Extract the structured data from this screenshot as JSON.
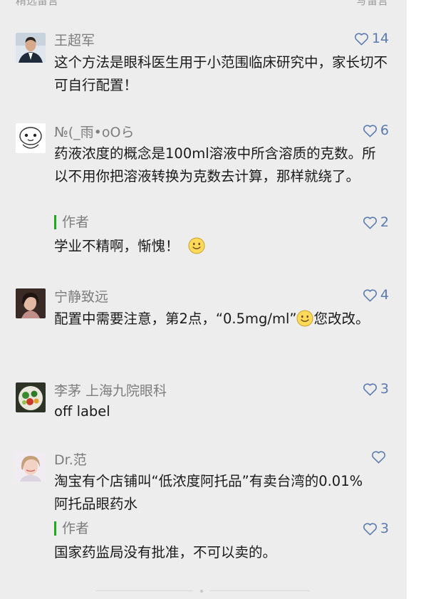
{
  "header_fragment": {
    "left": "精选留言",
    "right": "写留言"
  },
  "colors": {
    "like": "#5a7ab0",
    "author_bar": "#1aad19",
    "nickname": "#7d7d7d"
  },
  "comments": [
    {
      "nickname": "王超军",
      "likes": "14",
      "text": "这个方法是眼科医生用于小范围临床研究中，家长切不可自行配置！"
    },
    {
      "nickname": "№(_雨•oOら",
      "likes": "6",
      "text": "药液浓度的概念是100ml溶液中所含溶质的克数。所以不用你把溶液转换为克数去计算，那样就绕了。",
      "reply": {
        "label": "作者",
        "likes": "2",
        "text": "学业不精啊，惭愧！"
      }
    },
    {
      "nickname": "宁静致远",
      "likes": "4",
      "text_before": "配置中需要注意，第2点，“0.5mg/ml”",
      "text_after": "您改改。"
    },
    {
      "nickname": "李茅 上海九院眼科",
      "likes": "3",
      "text": "off label"
    },
    {
      "nickname": "Dr.范",
      "likes": "",
      "text": "淘宝有个店铺叫“低浓度阿托品”有卖台湾的0.01%阿托品眼药水",
      "reply": {
        "label": "作者",
        "likes": "3",
        "text": "国家药监局没有批准，不可以卖的。"
      }
    }
  ]
}
